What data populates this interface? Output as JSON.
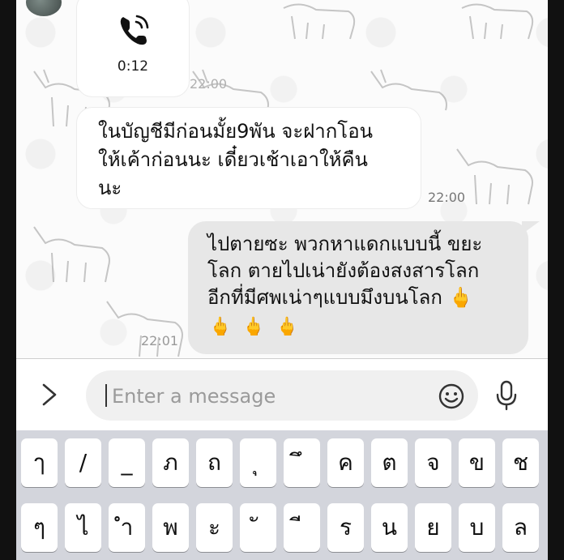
{
  "call": {
    "icon": "phone-call-icon",
    "duration": "0:12",
    "time": "22:00"
  },
  "incoming_message": {
    "text": "ในบัญชีมีก่อนมั้ย9พัน จะฝากโอน\nให้เค้าก่อนนะ  เดี๋ยวเช้าเอาให้คืน\nนะ",
    "time": "22:00"
  },
  "outgoing_message": {
    "text": "ไปตายซะ พวกหาแดกแบบนี้ ขยะ\nโลก ตายไปเน่ายังต้องสงสารโลก\nอีกที่มีศพเน่าๆแบบมึงบนโลก 🖕",
    "emoji": "🖕🖕🖕",
    "time": "22:01"
  },
  "input_bar": {
    "placeholder": "Enter a message",
    "expand_icon": "chevron-right-icon",
    "emoji_icon": "smiley-icon",
    "mic_icon": "microphone-icon"
  },
  "keyboard": {
    "row1": [
      "ๅ",
      "/",
      "_",
      "ภ",
      "ถ",
      "ุ",
      "ึ",
      "ค",
      "ต",
      "จ",
      "ข",
      "ช"
    ],
    "row2": [
      "ๆ",
      "ไ",
      "ำ",
      "พ",
      "ะ",
      "ั",
      "ี",
      "ร",
      "น",
      "ย",
      "บ",
      "ล"
    ]
  },
  "colors": {
    "incoming_bubble": "#ffffff",
    "outgoing_bubble": "#e7e7e7",
    "keyboard_bg": "#d3d5dc"
  }
}
